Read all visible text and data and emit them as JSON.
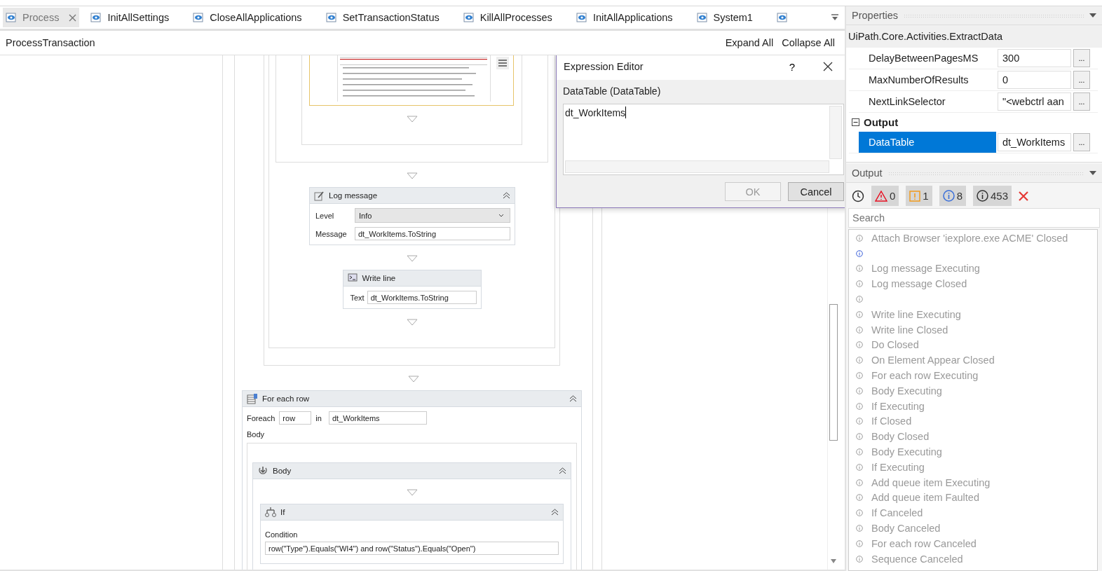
{
  "tabs": [
    {
      "label": "Process",
      "selected": true,
      "closable": true
    },
    {
      "label": "InitAllSettings",
      "selected": false,
      "closable": false
    },
    {
      "label": "CloseAllApplications",
      "selected": false,
      "closable": false
    },
    {
      "label": "SetTransactionStatus",
      "selected": false,
      "closable": false
    },
    {
      "label": "KillAllProcesses",
      "selected": false,
      "closable": false
    },
    {
      "label": "InitAllApplications",
      "selected": false,
      "closable": false
    },
    {
      "label": "System1",
      "selected": false,
      "closable": false
    },
    {
      "selected": false,
      "closable": false
    }
  ],
  "breadcrumb": "ProcessTransaction",
  "canvas_actions": [
    "Expand All",
    "Collapse All"
  ],
  "workflow": {
    "log_message": {
      "title": "Log message",
      "level_label": "Level",
      "level": "Info",
      "message_label": "Message",
      "message": "dt_WorkItems.ToString"
    },
    "write_line": {
      "title": "Write line",
      "text_label": "Text",
      "text": "dt_WorkItems.ToString"
    },
    "for_each": {
      "title": "For each row",
      "foreach_label": "Foreach",
      "item": "row",
      "in_label": "in",
      "collection": "dt_WorkItems",
      "body_label": "Body"
    },
    "body": {
      "title": "Body"
    },
    "if": {
      "title": "If",
      "condition_label": "Condition",
      "condition": "row(\"Type\").Equals(\"WI4\") and row(\"Status\").Equals(\"Open\")"
    }
  },
  "dialog": {
    "title": "Expression Editor",
    "help": "?",
    "label": "DataTable (DataTable)",
    "value": "dt_WorkItems",
    "buttons": [
      {
        "label": "OK",
        "disabled": true
      },
      {
        "label": "Cancel",
        "disabled": false
      }
    ]
  },
  "properties": {
    "title": "Properties",
    "subject": "UiPath.Core.Activities.ExtractData",
    "rows": [
      {
        "kind": "property",
        "name": "DelayBetweenPagesMS",
        "value": "300",
        "button": "...",
        "selected": false
      },
      {
        "kind": "property",
        "name": "MaxNumberOfResults",
        "value": "0",
        "button": "...",
        "selected": false
      },
      {
        "kind": "property",
        "name": "NextLinkSelector",
        "value": "\"<webctrl aan",
        "button": "...",
        "selected": false
      },
      {
        "kind": "category",
        "name": "Output",
        "expanded": true
      },
      {
        "kind": "property",
        "name": "DataTable",
        "value": "dt_WorkItems",
        "button": "...",
        "selected": true
      }
    ]
  },
  "output": {
    "title": "Output",
    "filters": [
      {
        "kind": "error",
        "count": "0",
        "on": true
      },
      {
        "kind": "warning",
        "count": "1",
        "on": true
      },
      {
        "kind": "info",
        "count": "8",
        "on": true
      },
      {
        "kind": "trace",
        "count": "453",
        "on": true
      }
    ],
    "search": {
      "placeholder": "Search"
    },
    "messages": [
      {
        "kind": "trace",
        "text": "Attach Browser 'iexplore.exe ACME' Closed"
      },
      {
        "kind": "info"
      },
      {
        "kind": "trace",
        "text": "Log message Executing"
      },
      {
        "kind": "trace",
        "text": "Log message Closed"
      },
      {
        "kind": "trace"
      },
      {
        "kind": "trace",
        "text": "Write line Executing"
      },
      {
        "kind": "trace",
        "text": "Write line Closed"
      },
      {
        "kind": "trace",
        "text": "Do Closed"
      },
      {
        "kind": "trace",
        "text": "On Element Appear Closed"
      },
      {
        "kind": "trace",
        "text": "For each row Executing"
      },
      {
        "kind": "trace",
        "text": "Body Executing"
      },
      {
        "kind": "trace",
        "text": "If Executing"
      },
      {
        "kind": "trace",
        "text": "If Closed"
      },
      {
        "kind": "trace",
        "text": "Body Closed"
      },
      {
        "kind": "trace",
        "text": "Body Executing"
      },
      {
        "kind": "trace",
        "text": "If Executing"
      },
      {
        "kind": "trace",
        "text": "Add queue item Executing"
      },
      {
        "kind": "trace",
        "text": "Add queue item Faulted"
      },
      {
        "kind": "trace",
        "text": "If Canceled"
      },
      {
        "kind": "trace",
        "text": "Body Canceled"
      },
      {
        "kind": "trace",
        "text": "For each row Canceled"
      },
      {
        "kind": "trace",
        "text": "Sequence Canceled"
      }
    ]
  }
}
